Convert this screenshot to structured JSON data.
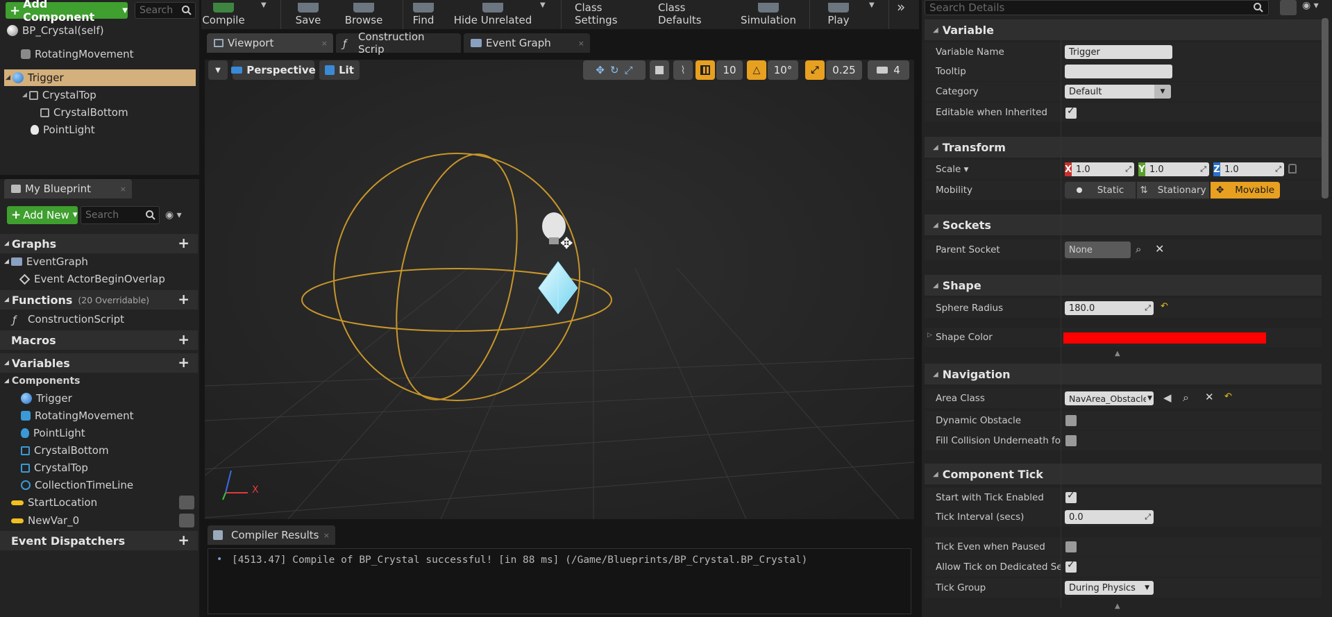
{
  "components_panel": {
    "add_component": "Add Component",
    "search_placeholder": "Search",
    "tree": [
      "BP_Crystal(self)",
      "RotatingMovement",
      "Trigger",
      "CrystalTop",
      "CrystalBottom",
      "PointLight"
    ]
  },
  "my_blueprint": {
    "tab": "My Blueprint",
    "add_new": "Add New",
    "search_placeholder": "Search",
    "graphs_header": "Graphs",
    "event_graph": "EventGraph",
    "event_begin_overlap": "Event ActorBeginOverlap",
    "functions_header": "Functions",
    "functions_note": "(20 Overridable)",
    "construction_script": "ConstructionScript",
    "macros_header": "Macros",
    "variables_header": "Variables",
    "components_header": "Components",
    "components": [
      "Trigger",
      "RotatingMovement",
      "PointLight",
      "CrystalBottom",
      "CrystalTop",
      "CollectionTimeLine"
    ],
    "vars": [
      "StartLocation",
      "NewVar_0"
    ],
    "dispatchers_header": "Event Dispatchers"
  },
  "toolbar": {
    "compile": "Compile",
    "save": "Save",
    "browse": "Browse",
    "find": "Find",
    "hide_unrelated": "Hide Unrelated",
    "class_settings": "Class Settings",
    "class_defaults": "Class Defaults",
    "simulation": "Simulation",
    "play": "Play"
  },
  "tabs": [
    "Viewport",
    "Construction Scrip",
    "Event Graph"
  ],
  "viewport": {
    "perspective": "Perspective",
    "lit": "Lit",
    "grid_snap": "10",
    "rot_snap": "10°",
    "scale_snap": "0.25",
    "cam_speed": "4",
    "axis_x": "X"
  },
  "compiler": {
    "tab": "Compiler Results",
    "message": "[4513.47] Compile of BP_Crystal successful! [in 88 ms] (/Game/Blueprints/BP_Crystal.BP_Crystal)"
  },
  "details": {
    "search_placeholder": "Search Details",
    "variable": {
      "header": "Variable",
      "name_label": "Variable Name",
      "name_value": "Trigger",
      "tooltip_label": "Tooltip",
      "category_label": "Category",
      "category_value": "Default",
      "editable_label": "Editable when Inherited"
    },
    "transform": {
      "header": "Transform",
      "scale_label": "Scale",
      "x": "X",
      "y": "Y",
      "z": "Z",
      "sx": "1.0",
      "sy": "1.0",
      "sz": "1.0",
      "mobility_label": "Mobility",
      "static": "Static",
      "stationary": "Stationary",
      "movable": "Movable"
    },
    "sockets": {
      "header": "Sockets",
      "parent_label": "Parent Socket",
      "parent_value": "None"
    },
    "shape": {
      "header": "Shape",
      "radius_label": "Sphere Radius",
      "radius_value": "180.0",
      "color_label": "Shape Color",
      "color": "#ff0000"
    },
    "navigation": {
      "header": "Navigation",
      "area_label": "Area Class",
      "area_value": "NavArea_Obstacle",
      "dynamic_label": "Dynamic Obstacle",
      "fill_label": "Fill Collision Underneath for Nav"
    },
    "tick": {
      "header": "Component Tick",
      "start_label": "Start with Tick Enabled",
      "interval_label": "Tick Interval (secs)",
      "interval_value": "0.0",
      "paused_label": "Tick Even when Paused",
      "dedicated_label": "Allow Tick on Dedicated Server",
      "group_label": "Tick Group",
      "group_value": "During Physics"
    }
  },
  "colors": {
    "accent_green": "#3f9f2f",
    "selection": "#d3b07c",
    "trigger_wire": "#c8962a",
    "movable_orange": "#e8a020"
  }
}
